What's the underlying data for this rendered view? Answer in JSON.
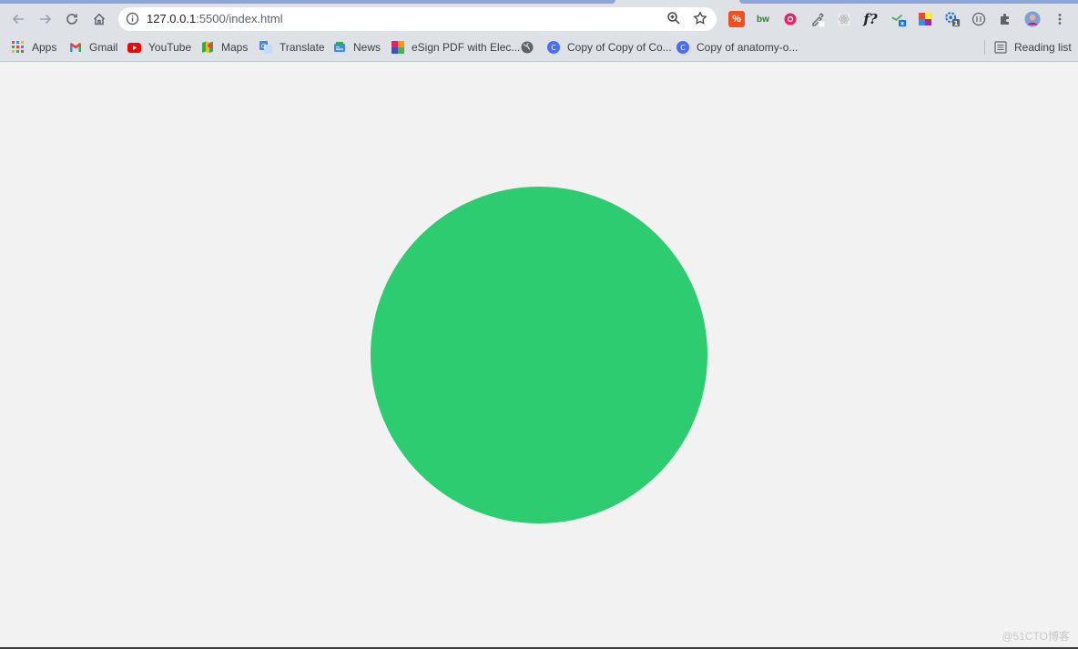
{
  "window": {
    "url_host": "127.0.0.1",
    "url_rest": ":5500/index.html"
  },
  "bookmarks": [
    {
      "label": "Apps",
      "icon": "apps-grid-icon"
    },
    {
      "label": "Gmail",
      "icon": "gmail-icon"
    },
    {
      "label": "YouTube",
      "icon": "youtube-icon"
    },
    {
      "label": "Maps",
      "icon": "maps-icon"
    },
    {
      "label": "Translate",
      "icon": "translate-icon"
    },
    {
      "label": "News",
      "icon": "news-icon"
    },
    {
      "label": "eSign PDF with Elec...",
      "icon": "esign-icon"
    },
    {
      "label": "",
      "icon": "globe-icon"
    },
    {
      "label": "Copy of Copy of Co...",
      "icon": "canva-icon"
    },
    {
      "label": "Copy of anatomy-o...",
      "icon": "canva-icon"
    }
  ],
  "reading_list": {
    "label": "Reading list",
    "icon": "reading-list-icon"
  },
  "page": {
    "circle_color": "#2ecc71",
    "background": "#f2f2f2"
  },
  "watermark": "@51CTO博客",
  "colors": {
    "chrome_bg": "#dee1e6",
    "accent": "#8fa6d9"
  }
}
